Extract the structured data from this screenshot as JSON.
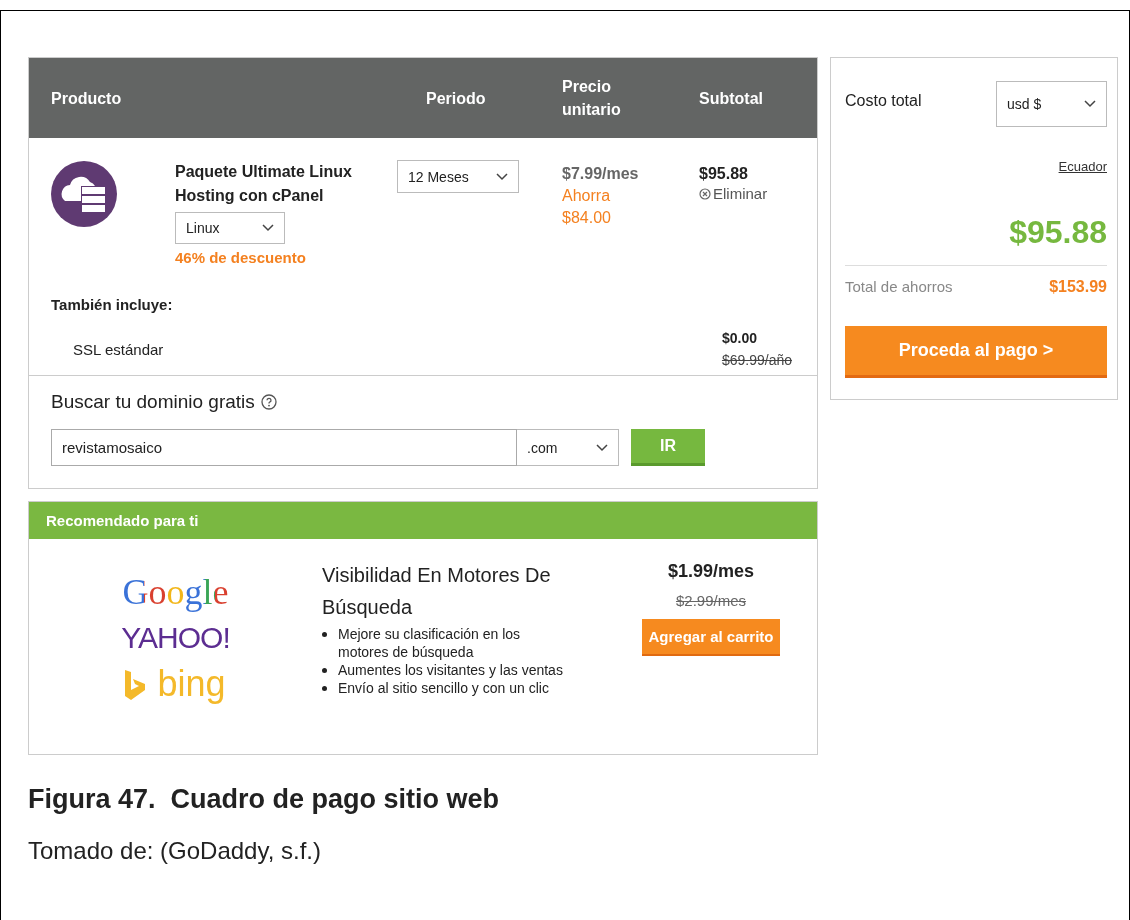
{
  "cart": {
    "columns": [
      "Producto",
      "Periodo",
      "Precio unitario",
      "Subtotal"
    ],
    "item": {
      "name": "Paquete Ultimate Linux Hosting con cPanel",
      "os": "Linux",
      "discount": "46% de descuento",
      "period": "12 Meses",
      "unit_price": "$7.99/mes",
      "savings": "Ahorra $84.00",
      "subtotal": "$95.88",
      "remove": "Eliminar"
    },
    "includes_title": "También incluye:",
    "includes": [
      {
        "name": "SSL estándar",
        "price": "$0.00",
        "old_price": "$69.99/año"
      }
    ]
  },
  "domain_search": {
    "title": "Buscar tu dominio gratis",
    "value": "revistamosaico",
    "tld": ".com",
    "button": "IR"
  },
  "recommended": {
    "title": "Recomendado para ti",
    "logos": [
      "Google",
      "YAHOO!",
      "bing"
    ],
    "product": "Visibilidad En Motores De Búsqueda",
    "bullets": [
      "Mejore su clasificación en los motores de búsqueda",
      "Aumentes los visitantes y las ventas",
      "Envío al sitio sencillo y con un clic"
    ],
    "price": "$1.99/mes",
    "old_price": "$2.99/mes",
    "button": "Agregar al carrito"
  },
  "summary": {
    "label": "Costo total",
    "currency": "usd $",
    "country": "Ecuador",
    "total": "$95.88",
    "savings_label": "Total de ahorros",
    "savings": "$153.99",
    "button": "Proceda al pago >"
  },
  "caption": {
    "title": "Figura 47.  Cuadro de pago sitio web",
    "source": "Tomado de: (GoDaddy, s.f.)"
  }
}
